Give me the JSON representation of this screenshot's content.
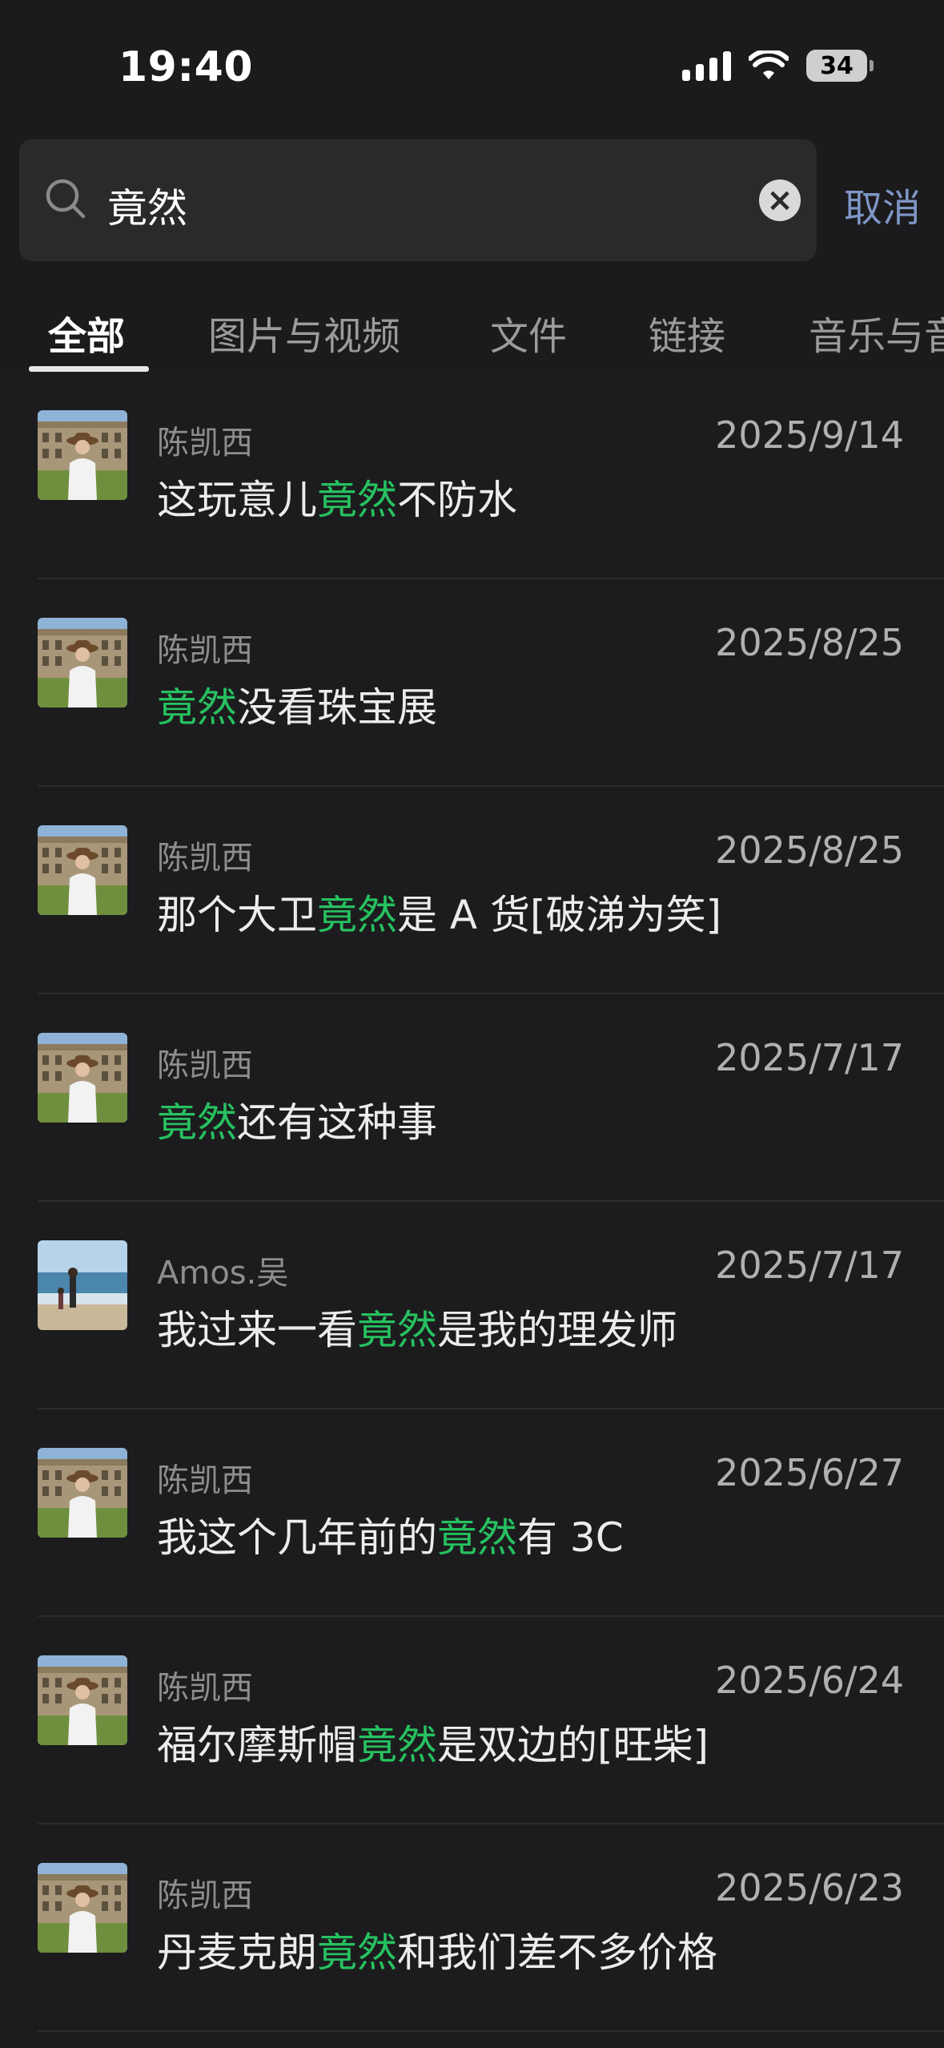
{
  "status": {
    "time": "19:40",
    "battery": "34"
  },
  "search": {
    "query": "竟然",
    "cancel_label": "取消"
  },
  "tabs": [
    {
      "label": "全部"
    },
    {
      "label": "图片与视频"
    },
    {
      "label": "文件"
    },
    {
      "label": "链接"
    },
    {
      "label": "音乐与音"
    }
  ],
  "keyword": "竟然",
  "results": [
    {
      "sender": "陈凯西",
      "date": "2025/9/14",
      "before": "这玩意儿",
      "after": "不防水"
    },
    {
      "sender": "陈凯西",
      "date": "2025/8/25",
      "before": "",
      "after": "没看珠宝展"
    },
    {
      "sender": "陈凯西",
      "date": "2025/8/25",
      "before": "那个大卫",
      "after": "是 A 货[破涕为笑]"
    },
    {
      "sender": "陈凯西",
      "date": "2025/7/17",
      "before": "",
      "after": "还有这种事"
    },
    {
      "sender": "Amos.吴",
      "date": "2025/7/17",
      "before": "我过来一看",
      "after": "是我的理发师"
    },
    {
      "sender": "陈凯西",
      "date": "2025/6/27",
      "before": "我这个几年前的",
      "after": "有 3C"
    },
    {
      "sender": "陈凯西",
      "date": "2025/6/24",
      "before": "福尔摩斯帽",
      "after": "是双边的[旺柴]"
    },
    {
      "sender": "陈凯西",
      "date": "2025/6/23",
      "before": "丹麦克朗",
      "after": "和我们差不多价格"
    }
  ],
  "colors": {
    "highlight": "#27c160",
    "link": "#7f96c6",
    "background": "#1c1c1e"
  }
}
